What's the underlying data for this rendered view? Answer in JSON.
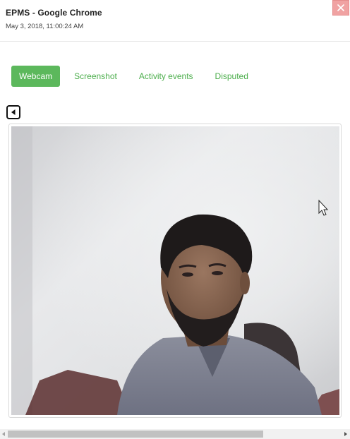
{
  "window": {
    "title": "EPMS - Google Chrome",
    "timestamp": "May 3, 2018, 11:00:24 AM"
  },
  "tabs": [
    {
      "label": "Webcam",
      "active": true
    },
    {
      "label": "Screenshot",
      "active": false
    },
    {
      "label": "Activity events",
      "active": false
    },
    {
      "label": "Disputed",
      "active": false
    }
  ],
  "colors": {
    "accent": "#5cb85c",
    "tab_text": "#4cae4c",
    "close": "#f0a2a2"
  },
  "icons": {
    "close": "close-icon",
    "back": "triangle-left-icon"
  }
}
